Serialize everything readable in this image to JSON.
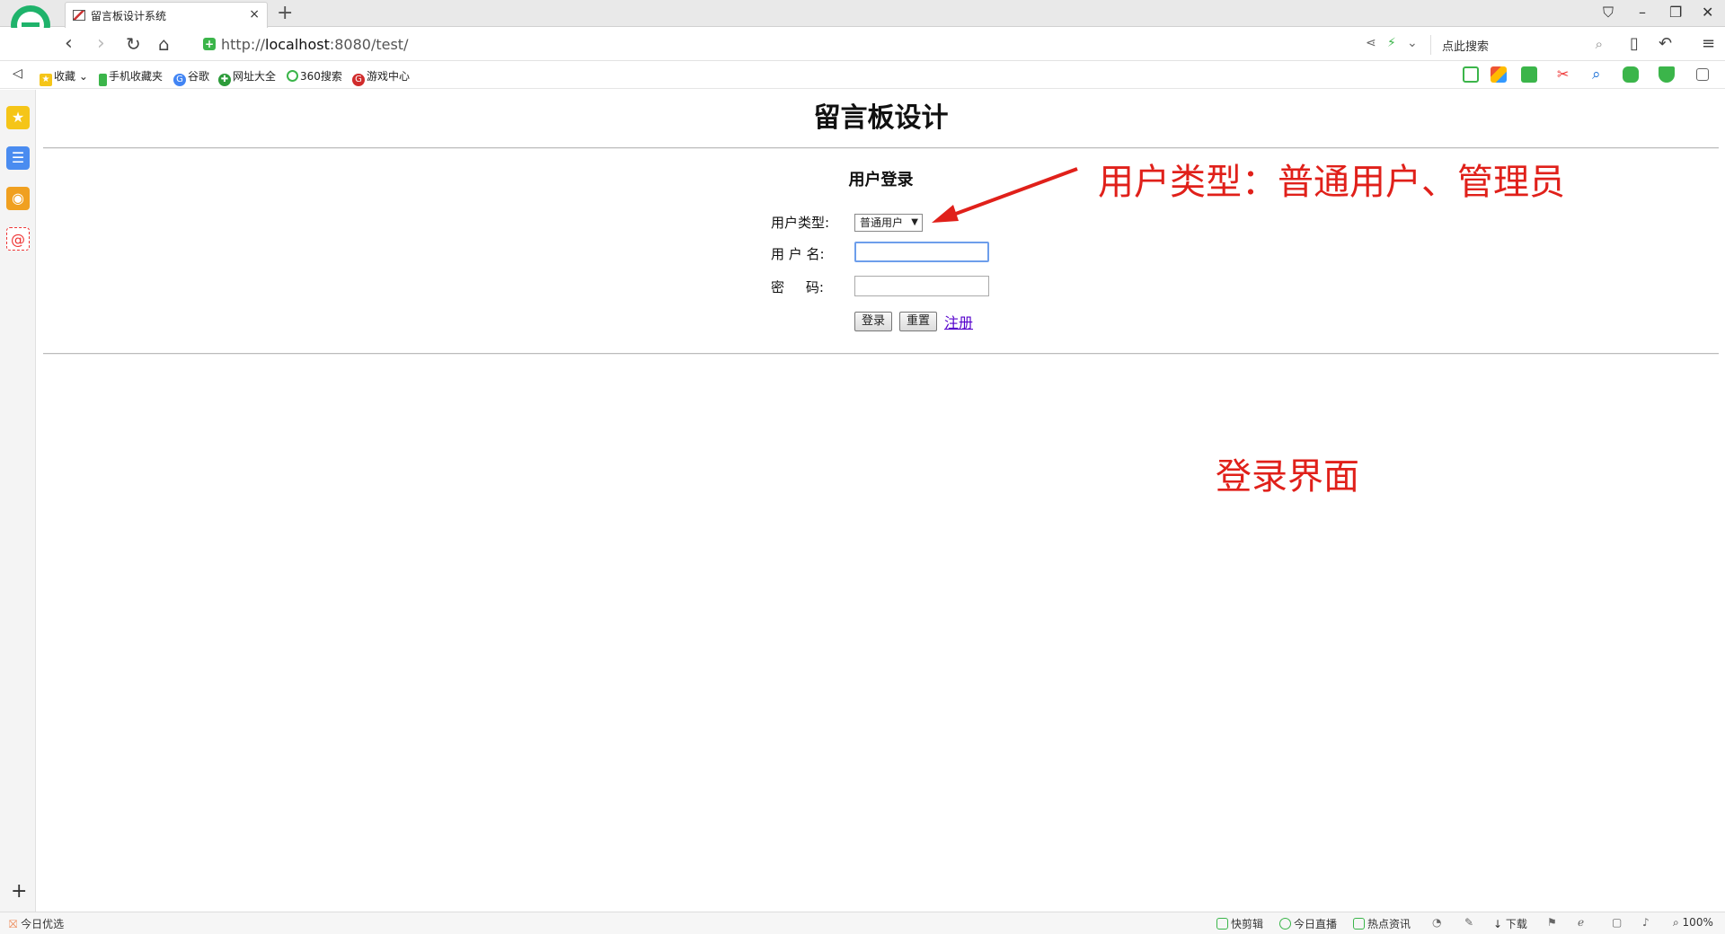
{
  "browser": {
    "tab_title": "留言板设计系统",
    "url_prefix": "http://",
    "url_host": "localhost",
    "url_rest": ":8080/test/",
    "search_placeholder": "点此搜索",
    "favorites": [
      "收藏",
      "手机收藏夹",
      "谷歌",
      "网址大全",
      "360搜索",
      "游戏中心"
    ]
  },
  "page": {
    "heading": "留言板设计",
    "login_title": "用户登录",
    "user_type_label": "用户类型:",
    "user_type_selected": "普通用户",
    "username_label": "用 户 名:",
    "password_label": "密     码:",
    "login_button": "登录",
    "reset_button": "重置",
    "register_link": "注册"
  },
  "annotations": {
    "user_type_note": "用户类型：普通用户、管理员",
    "screen_note": "登录界面"
  },
  "statusbar": {
    "left": "今日优选",
    "items": [
      "快剪辑",
      "今日直播",
      "热点资讯",
      "下载",
      "100%"
    ]
  },
  "colors": {
    "annotation": "#e0201a",
    "link": "#5500cc",
    "focus_border": "#6d9eeb"
  }
}
